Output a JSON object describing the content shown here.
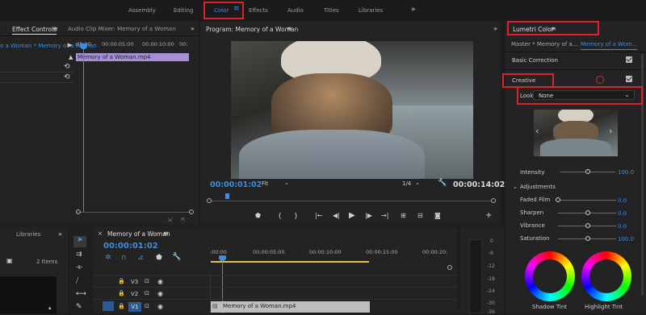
{
  "workspace": {
    "tabs": [
      "Assembly",
      "Editing",
      "Color",
      "Effects",
      "Audio",
      "Titles",
      "Libraries"
    ],
    "active": "Color",
    "more": "»"
  },
  "effect_controls": {
    "tab_label": "Effect Controls",
    "tab2_label": "Audio Clip Mixer: Memory of a Woman",
    "seq_label": "o a Woman * Memory of a Woman",
    "times": [
      ":00:00",
      "00:00:05:00",
      "00:00:10:00",
      "00:"
    ],
    "clip": "Memory of a Woman.mp4"
  },
  "program": {
    "title": "Program: Memory of a Woman",
    "timecode_left": "00:00:01:02",
    "fit": "Fit",
    "quality": "1/4",
    "timecode_right": "00:00:14:02"
  },
  "lumetri": {
    "title": "Lumetri Color",
    "master": "Master * Memory of a...",
    "clip_link": "Memory of a Wom...",
    "basic_correction": "Basic Correction",
    "creative": "Creative",
    "look_label": "Look",
    "look_value": "None",
    "intensity_label": "Intensity",
    "intensity_value": "100.0",
    "adjustments": "Adjustments",
    "rows": [
      {
        "label": "Faded Film",
        "value": "0.0"
      },
      {
        "label": "Sharpen",
        "value": "0.0"
      },
      {
        "label": "Vibrance",
        "value": "0.0"
      },
      {
        "label": "Saturation",
        "value": "100.0"
      }
    ],
    "wheel_left": "Shadow Tint",
    "wheel_right": "Highlight Tint"
  },
  "project": {
    "tab": "Libraries",
    "items": "2 Items"
  },
  "timeline": {
    "title": "Memory of a Woman",
    "timecode": "00:00:01:02",
    "ruler": [
      ":00:00",
      "00:00:05:00",
      "00:00:10:00",
      "00:00:15:00",
      "00:00:20:"
    ],
    "tracks": [
      "V3",
      "V2",
      "V1"
    ],
    "clip": "Memory of a Woman.mp4"
  },
  "meter": {
    "labels": [
      "0",
      "-6",
      "-12",
      "-18",
      "-24",
      "-30",
      "-36"
    ]
  },
  "colors": {
    "accent": "#3a8ee6",
    "highlight": "#e0202a",
    "clip": "#a78fd6",
    "workarea": "#e3c43a"
  }
}
